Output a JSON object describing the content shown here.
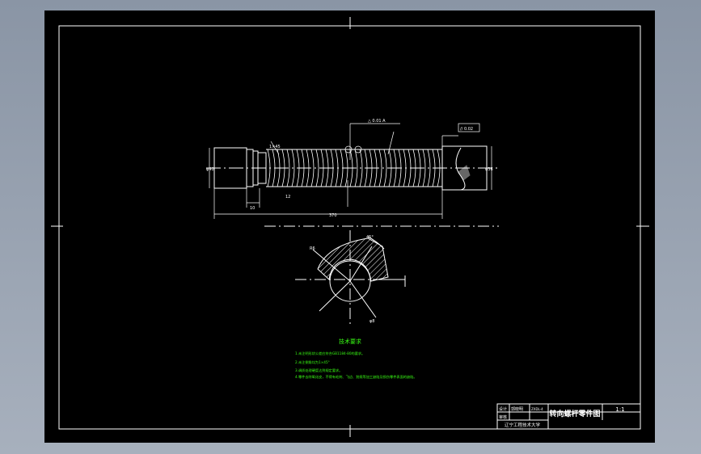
{
  "title_block": {
    "part_name": "转向螺杆零件图",
    "scale": "1:1",
    "designer_label": "设计",
    "designer_name": "郭晓明",
    "checker_label": "审核",
    "code": "ZXDL-4",
    "school": "辽宁工程技术大学"
  },
  "tech_requirements": {
    "heading": "技术要求",
    "items": [
      "1.未注明形状公差应符合GB1184-80的要求。",
      "2.未注倒角均为1×45°",
      "3.调质处理硬度达到规定要求。",
      "4.零件去除氧化皮，不得有毛刺、飞边、划痕等加工缺陷及损伤零件表面的缺陷。"
    ]
  },
  "dimensions": {
    "total_length": "370",
    "left_diameter": "φ40",
    "right_diameter": "φ36",
    "left_offset": "10",
    "chamfer": "1×45",
    "thread_pitch": "12",
    "tolerance_note": "△ 0.01 A",
    "datum_frame": "// 0.02",
    "section_angle": "45°",
    "section_dim": "R6",
    "section_radius": "φ8"
  },
  "colors": {
    "line": "#ffffff",
    "note": "#39ff14",
    "paper": "#000000"
  }
}
